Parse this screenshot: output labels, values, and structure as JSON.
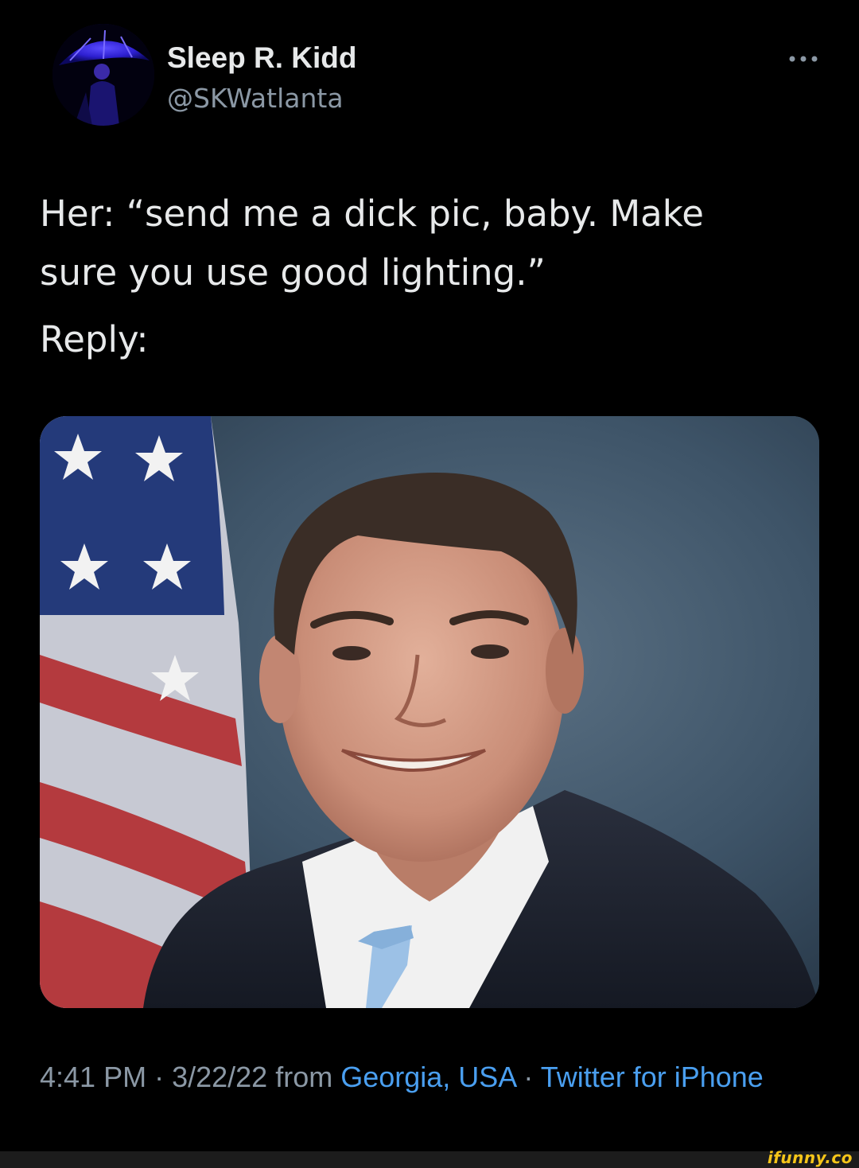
{
  "tweet": {
    "author": {
      "display_name": "Sleep R. Kidd",
      "handle": "@SKWatlanta",
      "avatar_icon": "profile-avatar"
    },
    "more_icon": "more-options-icon",
    "text_lines": [
      "Her:  “send me a dick pic, baby.  Make",
      "sure you use good lighting.”",
      "Reply:"
    ],
    "media": {
      "description_icon": "portrait-photo"
    },
    "meta": {
      "time": "4:41 PM",
      "separator": " · ",
      "date": "3/22/22",
      "from_text": " from ",
      "location": "Georgia, USA",
      "separator2": " · ",
      "source": "Twitter for iPhone"
    }
  },
  "watermark": {
    "text": "ifunny.co"
  },
  "colors": {
    "background": "#000000",
    "primary_text": "#e7e9ea",
    "secondary_text": "#8b98a5",
    "link": "#4a9ff0",
    "watermark": "#f6c519"
  }
}
